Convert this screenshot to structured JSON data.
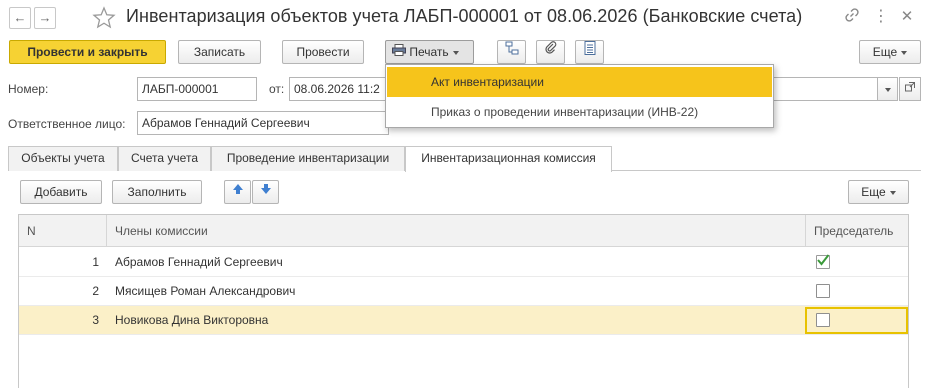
{
  "header": {
    "title": "Инвентаризация объектов учета ЛАБП-000001 от 08.06.2026 (Банковские счета)"
  },
  "toolbar": {
    "post_close_label": "Провести и закрыть",
    "save_label": "Записать",
    "post_label": "Провести",
    "print_label": "Печать",
    "more_label": "Еще"
  },
  "print_menu": {
    "items": [
      {
        "label": "Акт инвентаризации"
      },
      {
        "label": "Приказ о проведении инвентаризации (ИНВ-22)"
      }
    ]
  },
  "form": {
    "number_label": "Номер:",
    "number_value": "ЛАБП-000001",
    "date_label": "от:",
    "date_value": "08.06.2026 11:2",
    "responsible_label": "Ответственное лицо:",
    "responsible_value": "Абрамов Геннадий Сергеевич"
  },
  "tabs": [
    {
      "label": "Объекты учета"
    },
    {
      "label": "Счета учета"
    },
    {
      "label": "Проведение инвентаризации"
    },
    {
      "label": "Инвентаризационная комиссия"
    }
  ],
  "table_toolbar": {
    "add_label": "Добавить",
    "fill_label": "Заполнить",
    "more_label": "Еще"
  },
  "commission_table": {
    "columns": [
      "N",
      "Члены комиссии",
      "Председатель"
    ],
    "rows": [
      {
        "n": "1",
        "member": "Абрамов Геннадий Сергеевич",
        "chairman": true
      },
      {
        "n": "2",
        "member": "Мясищев Роман Александрович",
        "chairman": false
      },
      {
        "n": "3",
        "member": "Новикова Дина Викторовна",
        "chairman": false
      }
    ]
  },
  "colors": {
    "accent": "#f6d233",
    "menu_highlight": "#f6c41b",
    "selected_row": "#fbf0c8",
    "check_green": "#3a9a3a"
  }
}
